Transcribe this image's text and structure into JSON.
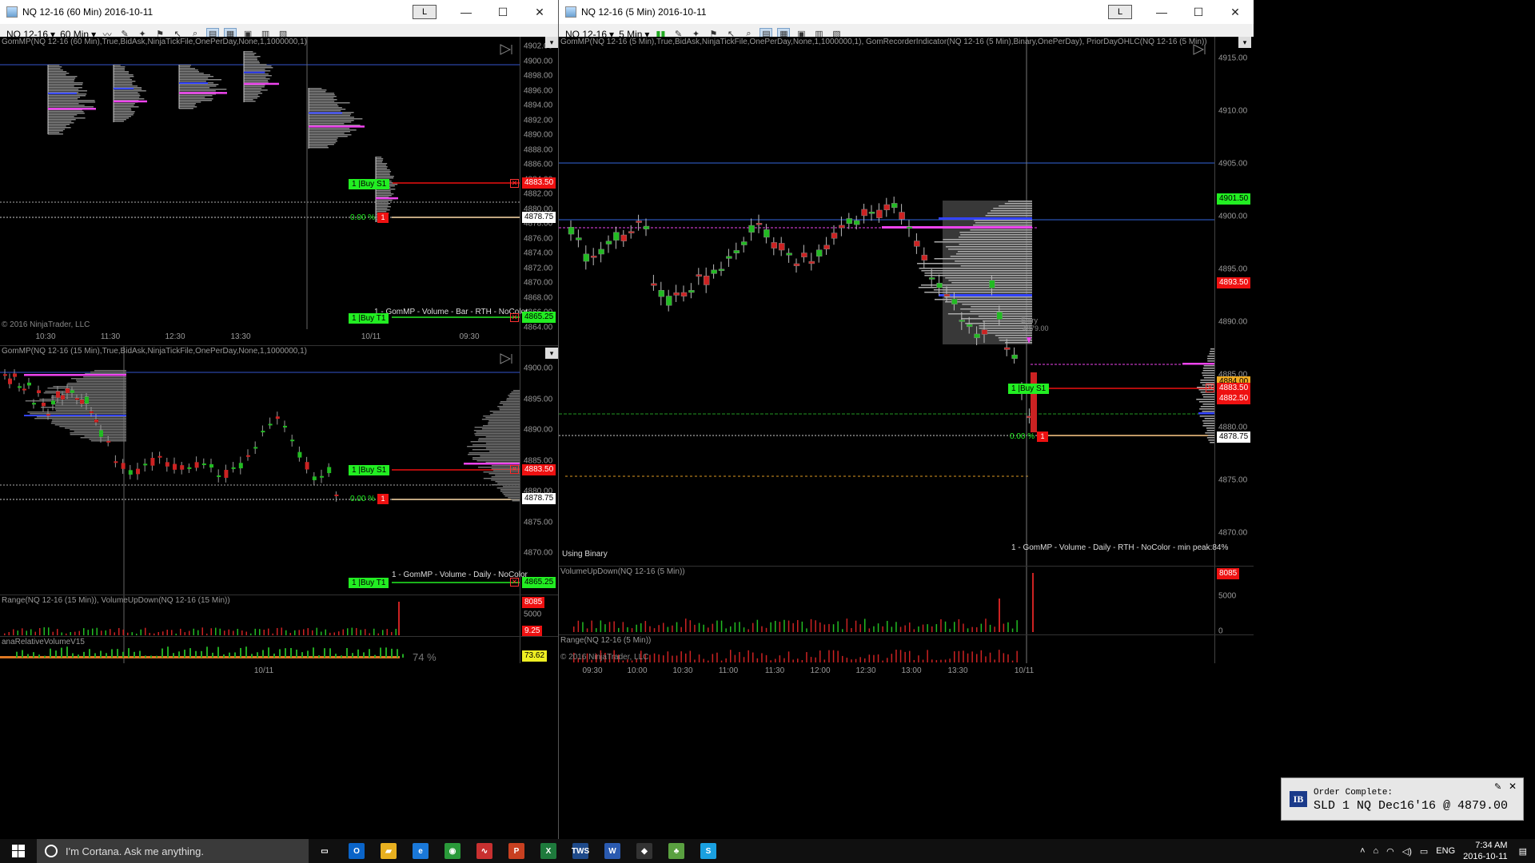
{
  "windows": {
    "top_left": {
      "title": "NQ 12-16 (60 Min)  2016-10-11",
      "layout_badge": "L",
      "instrument": "NQ 12-16",
      "period": "60 Min",
      "indicator_title": "GomMP(NQ 12-16 (60 Min),True,BidAsk,NinjaTickFile,OnePerDay,None,1,1000000,1)",
      "price_ticks": [
        "4902.00",
        "4900.00",
        "4898.00",
        "4896.00",
        "4894.00",
        "4892.00",
        "4890.00",
        "4888.00",
        "4886.00",
        "4884.00",
        "4882.00",
        "4880.00",
        "4878.00",
        "4876.00",
        "4874.00",
        "4872.00",
        "4870.00",
        "4868.00",
        "4866.00",
        "4864.00"
      ],
      "x_labels": [
        "10:30",
        "11:30",
        "12:30",
        "13:30",
        "10/11",
        "09:30"
      ],
      "price_label_red": "4883.50",
      "price_label_white": "4878.75",
      "price_label_green": "4865.25",
      "order_buy_s1": "1 |Buy S1",
      "order_buy_t1": "1 |Buy T1",
      "pct_text": "0.00 %",
      "position_qty": "1",
      "profile_note": "1 - GomMP - Volume - Bar - RTH - NoColor",
      "copyright": "© 2016 NinjaTrader, LLC"
    },
    "bottom_left": {
      "indicator_title": "GomMP(NQ 12-16 (15 Min),True,BidAsk,NinjaTickFile,OnePerDay,None,1,1000000,1)",
      "price_ticks": [
        "4900.00",
        "4895.00",
        "4890.00",
        "4885.00",
        "4880.00",
        "4875.00",
        "4870.00"
      ],
      "price_label_red": "4883.50",
      "price_label_white": "4878.75",
      "price_label_green": "4865.25",
      "order_buy_s1": "1 |Buy S1",
      "order_buy_t1": "1 |Buy T1",
      "pct_text": "0.00 %",
      "position_qty": "1",
      "profile_note": "1 - GomMP - Volume - Daily - NoColor",
      "sub1_title": "Range(NQ 12-16 (15 Min)), VolumeUpDown(NQ 12-16 (15 Min))",
      "sub1_ticks": [
        "5000"
      ],
      "sub1_label_red": "8085",
      "sub1_label_red2": "9.25",
      "sub2_title": "anaRelativeVolumeV15",
      "sub2_pct": "74 %",
      "sub2_label": "73.62",
      "copyright": "© 2016 NinjaTrader, LLC",
      "x_labels": [
        "10/11"
      ]
    },
    "right": {
      "title": "NQ 12-16 (5 Min)  2016-10-11",
      "layout_badge": "L",
      "instrument": "NQ 12-16",
      "period": "5 Min",
      "indicator_title": "GomMP(NQ 12-16 (5 Min),True,BidAsk,NinjaTickFile,OnePerDay,None,1,1000000,1), GomRecorderIndicator(NQ 12-16 (5 Min),Binary,OnePerDay), PriorDayOHLC(NQ 12-16 (5 Min))",
      "price_ticks": [
        "4915.00",
        "4910.00",
        "4905.00",
        "4900.00",
        "4895.00",
        "4890.00",
        "4885.00",
        "4880.00",
        "4875.00",
        "4870.00"
      ],
      "price_label_green": "4901.50",
      "price_label_red_upper": "4893.50",
      "price_label_yellow": "4884.00",
      "price_label_red": "4883.50",
      "price_label_red2": "4882.50",
      "price_label_white": "4878.75",
      "order_buy_s1": "1 |Buy S1",
      "pct_text": "0.00 %",
      "position_qty": "1",
      "entry_text": "Entry",
      "entry_price": "4879.00",
      "using_binary": "Using Binary",
      "profile_note": "1 - GomMP - Volume - Daily - RTH - NoColor - min peak:84%",
      "sub1_title": "VolumeUpDown(NQ 12-16 (5 Min))",
      "sub1_ticks": [
        "5000",
        "0"
      ],
      "sub1_label_red": "8085",
      "sub2_title": "Range(NQ 12-16 (5 Min))",
      "copyright": "© 2016 NinjaTrader, LLC",
      "x_labels": [
        "09:30",
        "10:00",
        "10:30",
        "11:00",
        "11:30",
        "12:00",
        "12:30",
        "13:00",
        "13:30",
        "10/11"
      ]
    }
  },
  "toast": {
    "title": "Order Complete:",
    "message": "SLD 1 NQ Dec16'16 @ 4879.00",
    "logo": "IB"
  },
  "taskbar": {
    "search_placeholder": "I'm Cortana. Ask me anything.",
    "apps": [
      {
        "name": "task-view",
        "label": "▭",
        "color": "#101010"
      },
      {
        "name": "outlook",
        "label": "O",
        "color": "#0a64c8"
      },
      {
        "name": "file-explorer",
        "label": "▰",
        "color": "#e8b020"
      },
      {
        "name": "edge",
        "label": "e",
        "color": "#1a78d8"
      },
      {
        "name": "chrome",
        "label": "◉",
        "color": "#2a9a3a"
      },
      {
        "name": "ninjatrader",
        "label": "∿",
        "color": "#c83030"
      },
      {
        "name": "powerpoint",
        "label": "P",
        "color": "#c84020"
      },
      {
        "name": "excel",
        "label": "X",
        "color": "#1e7a3c"
      },
      {
        "name": "tws",
        "label": "TWS",
        "color": "#1e4a8a"
      },
      {
        "name": "word",
        "label": "W",
        "color": "#2a5ab0"
      },
      {
        "name": "tradestation",
        "label": "◆",
        "color": "#333"
      },
      {
        "name": "app-green",
        "label": "♣",
        "color": "#5aa040"
      },
      {
        "name": "skype",
        "label": "S",
        "color": "#1aa0e0"
      }
    ],
    "language": "ENG",
    "time": "7:34 AM",
    "date": "2016-10-11"
  },
  "colors": {
    "green_label": "#22ee22",
    "red_label": "#ee1111",
    "profile_pink": "#ee44ee",
    "profile_blue": "#3344ff",
    "blue_line": "#3366dd"
  }
}
